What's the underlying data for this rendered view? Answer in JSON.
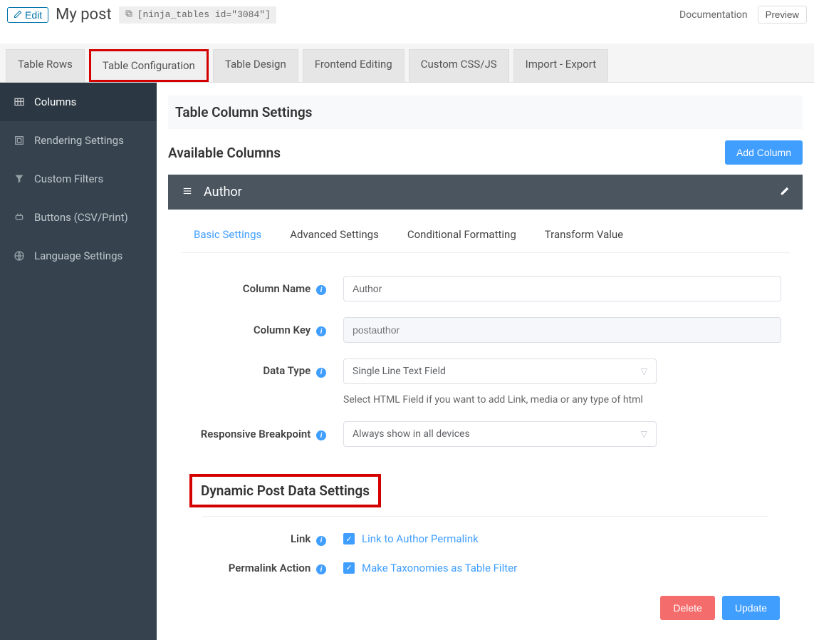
{
  "header": {
    "edit_label": "Edit",
    "title": "My post",
    "shortcode": "[ninja_tables id=\"3084\"]",
    "documentation": "Documentation",
    "preview": "Preview"
  },
  "tabs": [
    {
      "label": "Table Rows"
    },
    {
      "label": "Table Configuration",
      "highlighted": true
    },
    {
      "label": "Table Design"
    },
    {
      "label": "Frontend Editing"
    },
    {
      "label": "Custom CSS/JS"
    },
    {
      "label": "Import - Export"
    }
  ],
  "sidebar": {
    "items": [
      {
        "label": "Columns",
        "active": true,
        "icon": "table-icon"
      },
      {
        "label": "Rendering Settings",
        "icon": "render-icon"
      },
      {
        "label": "Custom Filters",
        "icon": "filter-icon"
      },
      {
        "label": "Buttons (CSV/Print)",
        "icon": "plug-icon"
      },
      {
        "label": "Language Settings",
        "icon": "lang-icon"
      }
    ]
  },
  "content": {
    "section_title": "Table Column Settings",
    "available_label": "Available Columns",
    "add_column_label": "Add Column",
    "column_header": "Author",
    "inner_tabs": [
      {
        "label": "Basic Settings",
        "active": true
      },
      {
        "label": "Advanced Settings"
      },
      {
        "label": "Conditional Formatting"
      },
      {
        "label": "Transform Value"
      }
    ],
    "form": {
      "column_name_label": "Column Name",
      "column_name_value": "Author",
      "column_key_label": "Column Key",
      "column_key_placeholder": "postauthor",
      "data_type_label": "Data Type",
      "data_type_value": "Single Line Text Field",
      "data_type_help": "Select HTML Field if you want to add Link, media or any type of html",
      "breakpoint_label": "Responsive Breakpoint",
      "breakpoint_value": "Always show in all devices"
    },
    "dynamic_title": "Dynamic Post Data Settings",
    "link_label": "Link",
    "link_checkbox": "Link to Author Permalink",
    "permalink_label": "Permalink Action",
    "permalink_checkbox": "Make Taxonomies as Table Filter",
    "delete_label": "Delete",
    "update_label": "Update"
  }
}
